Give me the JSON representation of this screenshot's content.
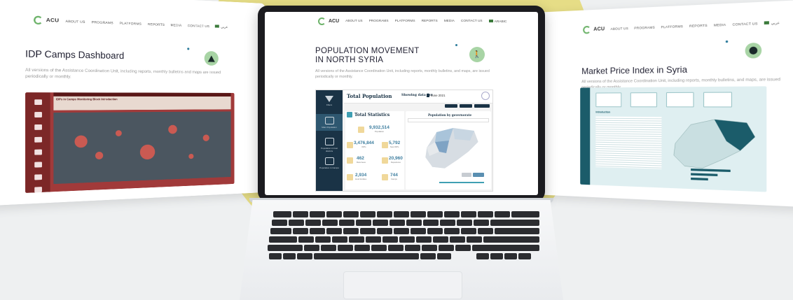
{
  "left_card": {
    "nav": {
      "logo": "ACU",
      "items": [
        "ABOUT US",
        "PROGRAMS",
        "PLATFORMS",
        "REPORTS",
        "MEDIA",
        "CONTACT US"
      ],
      "lang": "عربي"
    },
    "title": "IDP Camps Dashboard",
    "description": "All versions of the Assistance Coordination Unit, including reports, monthly bulletins and maps are issued periodically or monthly.",
    "dashboard_title": "IDPs in Camps Monitoring Block Introduction"
  },
  "center_screen": {
    "nav": {
      "logo": "ACU",
      "items": [
        "ABOUT US",
        "PROGRAMS",
        "PLATFORMS",
        "REPORTS",
        "MEDIA",
        "CONTACT US"
      ],
      "lang": "ARABIC"
    },
    "title_line1": "POPULATION MOVEMENT",
    "title_line2": "IN NORTH SYRIA",
    "description": "All versions of the Assistance Coordination Unit, including reports, monthly bulletins, and maps, are issued periodically or monthly.",
    "dashboard": {
      "title": "Total Population",
      "showing_label": "Showing data for:",
      "date": "June 2021",
      "section_title": "Total Statistics",
      "map_title": "Population by governorate",
      "sidebar": [
        "Filters",
        "Main Population",
        "Population in host districts",
        "Population in Camps"
      ],
      "stats": [
        {
          "value": "9,932,514",
          "label": "Population"
        },
        {
          "value": "3,476,844",
          "label": "IDPs"
        },
        {
          "value": "5,792",
          "label": "New IDPs"
        },
        {
          "value": "462",
          "label": "Returnees"
        },
        {
          "value": "20,960",
          "label": "Departures"
        },
        {
          "value": "2,934",
          "label": "Host families"
        },
        {
          "value": "744",
          "label": "Camps"
        }
      ]
    }
  },
  "right_card": {
    "nav": {
      "logo": "ACU",
      "items": [
        "ABOUT US",
        "PROGRAMS",
        "PLATFORMS",
        "REPORTS",
        "MEDIA",
        "CONTACT US"
      ],
      "lang": "عربي"
    },
    "title": "Market Price Index in Syria",
    "description": "All versions of the Assistance Coordination Unit, including reports, monthly bulletins, and maps, are issued periodically or monthly.",
    "dashboard_section": "Introduction"
  },
  "colors": {
    "accent_green": "#a8d4a5",
    "sun": "#e6dd86",
    "dashboard_navy": "#1a3346",
    "idp_red": "#a13a3a",
    "mpi_teal": "#1b5c6a"
  }
}
